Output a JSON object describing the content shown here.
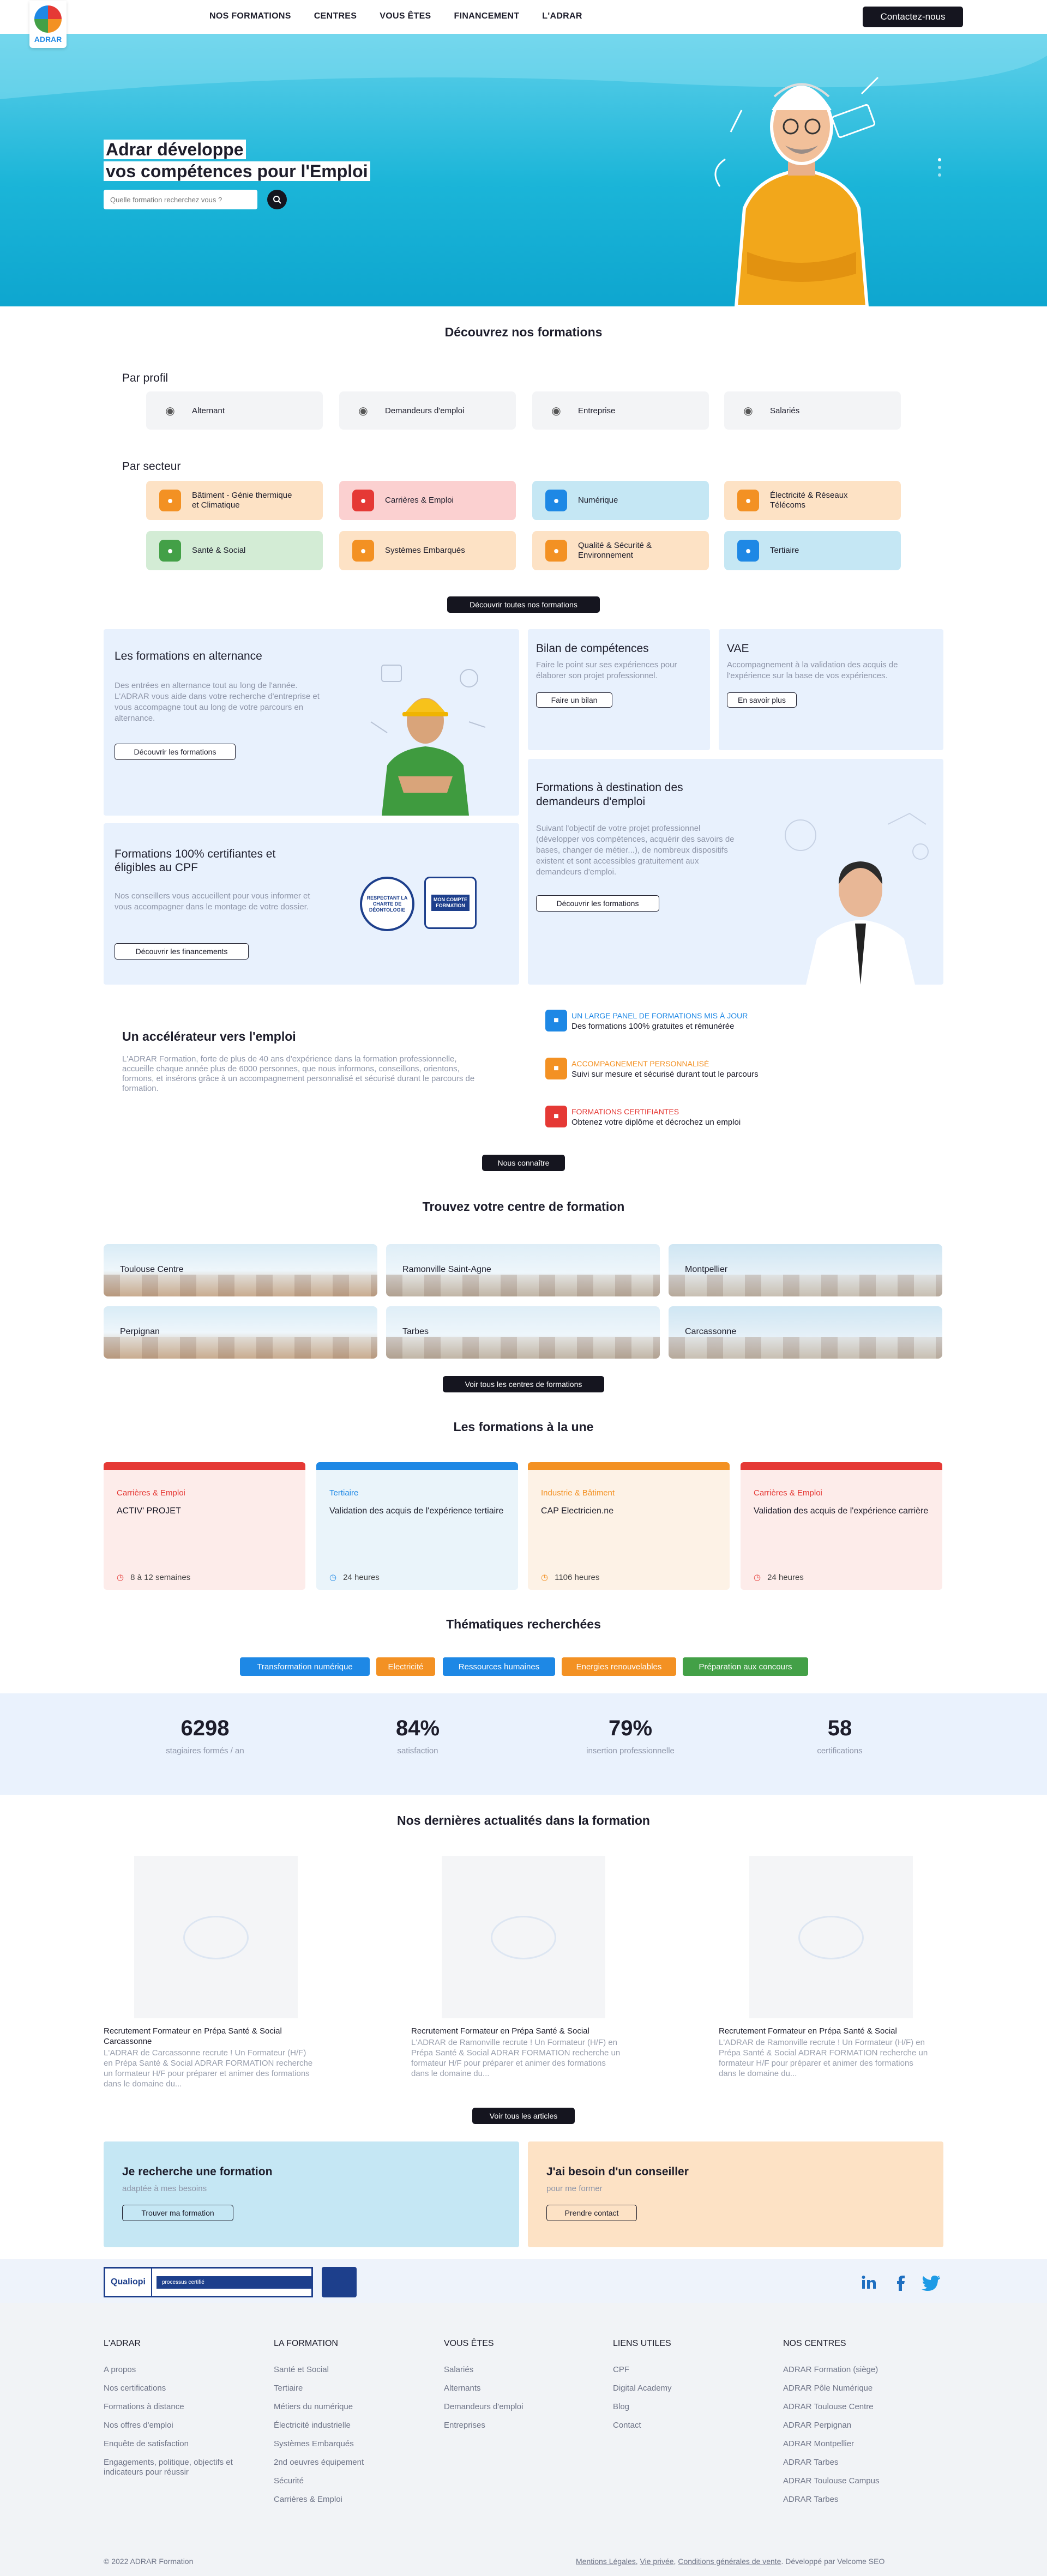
{
  "header": {
    "logo_text": "ADRAR",
    "nav": [
      "NOS FORMATIONS",
      "CENTRES",
      "VOUS ÊTES",
      "FINANCEMENT",
      "L'ADRAR"
    ],
    "cta": "Contactez-nous"
  },
  "hero": {
    "title_line1": "Adrar développe",
    "title_line2": "vos compétences pour l'Emploi",
    "search_placeholder": "Quelle formation recherchez vous ?"
  },
  "discover": {
    "title": "Découvrez nos formations",
    "profile_label": "Par profil",
    "profiles": [
      {
        "label": "Alternant",
        "icon": "person-icon"
      },
      {
        "label": "Demandeurs d'emploi",
        "icon": "job-seeker-icon"
      },
      {
        "label": "Entreprise",
        "icon": "building-icon"
      },
      {
        "label": "Salariés",
        "icon": "badge-icon"
      }
    ],
    "sector_label": "Par secteur",
    "sectors": [
      {
        "label": "Bâtiment - Génie thermique et Climatique",
        "bg": "#fde2c5",
        "icon_bg": "#f39123",
        "icon": "helmet-icon"
      },
      {
        "label": "Carrières & Emploi",
        "bg": "#fbd0d0",
        "icon_bg": "#e53935",
        "icon": "briefcase-icon"
      },
      {
        "label": "Numérique",
        "bg": "#c5e7f4",
        "icon_bg": "#1e88e5",
        "icon": "laptop-icon"
      },
      {
        "label": "Électricité & Réseaux Télécoms",
        "bg": "#fde2c5",
        "icon_bg": "#f39123",
        "icon": "bolt-icon"
      },
      {
        "label": "Santé & Social",
        "bg": "#d3ecd5",
        "icon_bg": "#43a047",
        "icon": "health-icon"
      },
      {
        "label": "Systèmes Embarqués",
        "bg": "#fde2c5",
        "icon_bg": "#f39123",
        "icon": "chip-icon"
      },
      {
        "label": "Qualité & Sécurité & Environnement",
        "bg": "#fde2c5",
        "icon_bg": "#f39123",
        "icon": "shield-icon"
      },
      {
        "label": "Tertiaire",
        "bg": "#c5e7f4",
        "icon_bg": "#1e88e5",
        "icon": "office-icon"
      }
    ],
    "all_button": "Découvrir toutes nos formations"
  },
  "cards": {
    "alternance": {
      "title": "Les formations en alternance",
      "text": "Des entrées en alternance tout au long de l'année. L'ADRAR vous aide dans votre recherche d'entreprise et vous accompagne tout au long de votre parcours en alternance.",
      "button": "Découvrir les formations"
    },
    "bilan": {
      "title": "Bilan de compétences",
      "text": "Faire le point sur ses expériences pour élaborer son projet professionnel.",
      "button": "Faire un bilan"
    },
    "vae": {
      "title": "VAE",
      "text": "Accompagnement à la validation des acquis de l'expérience sur la base de vos expériences.",
      "button": "En savoir plus"
    },
    "cpf": {
      "title": "Formations 100% certifiantes et éligibles au CPF",
      "text": "Nos conseillers vous accueillent pour vous informer et vous accompagner dans le montage de votre dossier.",
      "button": "Découvrir les financements",
      "badge1": "RESPECTANT LA CHARTE DE DÉONTOLOGIE",
      "badge2": "MON COMPTE FORMATION"
    },
    "demandeurs": {
      "title": "Formations à destination des demandeurs d'emploi",
      "text": "Suivant l'objectif de votre projet professionnel (développer vos compétences, acquérir des savoirs de bases, changer de métier...), de nombreux dispositifs existent et sont accessibles gratuitement aux demandeurs d'emploi.",
      "button": "Découvrir les formations"
    }
  },
  "accelerator": {
    "title": "Un accélérateur vers l'emploi",
    "text": "L'ADRAR Formation, forte de plus de 40 ans d'expérience dans la formation professionnelle, accueille chaque année plus de 6000 personnes, que nous informons, conseillons, orientons, formons, et insérons grâce à un accompagnement personnalisé et sécurisé durant le parcours de formation.",
    "points": [
      {
        "title": "UN LARGE PANEL DE FORMATIONS MIS À JOUR",
        "text": "Des formations 100% gratuites et rémunérée",
        "color": "#1e88e5",
        "icon": "list-icon"
      },
      {
        "title": "ACCOMPAGNEMENT PERSONNALISÉ",
        "text": "Suivi sur mesure et sécurisé durant tout le parcours",
        "color": "#f39123",
        "icon": "users-icon"
      },
      {
        "title": "FORMATIONS CERTIFIANTES",
        "text": "Obtenez votre diplôme et décrochez un emploi",
        "color": "#e53935",
        "icon": "certificate-icon"
      }
    ],
    "button": "Nous connaître"
  },
  "centres": {
    "title": "Trouvez votre centre de formation",
    "cities": [
      "Toulouse Centre",
      "Ramonville Saint-Agne",
      "Montpellier",
      "Perpignan",
      "Tarbes",
      "Carcassonne"
    ],
    "button": "Voir tous les centres de formations"
  },
  "featured": {
    "title": "Les formations à la une",
    "items": [
      {
        "category": "Carrières & Emploi",
        "title": "ACTIV' PROJET",
        "duration": "8 à 12 semaines",
        "color": "#e53935",
        "bg": "#fdecea"
      },
      {
        "category": "Tertiaire",
        "title": "Validation des acquis de l'expérience tertiaire",
        "duration": "24 heures",
        "color": "#1e88e5",
        "bg": "#eaf4fa"
      },
      {
        "category": "Industrie & Bâtiment",
        "title": "CAP Electricien.ne",
        "duration": "1106 heures",
        "color": "#f39123",
        "bg": "#fdf2e6"
      },
      {
        "category": "Carrières & Emploi",
        "title": "Validation des acquis de l'expérience carrière",
        "duration": "24 heures",
        "color": "#e53935",
        "bg": "#fdecea"
      }
    ]
  },
  "themes": {
    "title": "Thématiques recherchées",
    "tags": [
      {
        "label": "Transformation numérique",
        "color": "#1e88e5"
      },
      {
        "label": "Electricité",
        "color": "#f39123"
      },
      {
        "label": "Ressources humaines",
        "color": "#1e88e5"
      },
      {
        "label": "Energies renouvelables",
        "color": "#f39123"
      },
      {
        "label": "Préparation aux concours",
        "color": "#43a047"
      }
    ]
  },
  "stats": [
    {
      "value": "6298",
      "label": "stagiaires formés / an"
    },
    {
      "value": "84%",
      "label": "satisfaction"
    },
    {
      "value": "79%",
      "label": "insertion professionnelle"
    },
    {
      "value": "58",
      "label": "certifications"
    }
  ],
  "news": {
    "title": "Nos dernières actualités dans la formation",
    "items": [
      {
        "title": "Recrutement Formateur en Prépa Santé & Social Carcassonne",
        "text": "L'ADRAR de Carcassonne recrute ! Un Formateur (H/F) en Prépa Santé & Social ADRAR FORMATION recherche un formateur H/F pour préparer et animer des formations dans le domaine du..."
      },
      {
        "title": "Recrutement Formateur en Prépa Santé & Social",
        "text": "L'ADRAR de Ramonville recrute ! Un Formateur (H/F) en Prépa Santé & Social ADRAR FORMATION recherche un formateur H/F pour préparer et animer des formations dans le domaine du..."
      },
      {
        "title": "Recrutement Formateur en Prépa Santé & Social",
        "text": "L'ADRAR de Ramonville recrute ! Un Formateur (H/F) en Prépa Santé & Social ADRAR FORMATION recherche un formateur H/F pour préparer et animer des formations dans le domaine du..."
      }
    ],
    "button": "Voir tous les articles"
  },
  "cta_blocks": {
    "left": {
      "title": "Je recherche une formation",
      "sub": "adaptée à mes besoins",
      "button": "Trouver ma formation"
    },
    "right": {
      "title": "J'ai besoin d'un conseiller",
      "sub": "pour me former",
      "button": "Prendre contact"
    }
  },
  "partners": {
    "qualiopi": "Qualiopi",
    "qualiopi_sub": "processus certifié",
    "social": [
      "linkedin-icon",
      "facebook-icon",
      "twitter-icon"
    ]
  },
  "footer": {
    "columns": [
      {
        "title": "L'ADRAR",
        "items": [
          "A propos",
          "Nos certifications",
          "Formations à distance",
          "Nos offres d'emploi",
          "Enquête de satisfaction",
          "Engagements, politique, objectifs et indicateurs pour réussir"
        ]
      },
      {
        "title": "LA FORMATION",
        "items": [
          "Santé et Social",
          "Tertiaire",
          "Métiers du numérique",
          "Électricité industrielle",
          "Systèmes Embarqués",
          "2nd oeuvres équipement",
          "Sécurité",
          "Carrières & Emploi"
        ]
      },
      {
        "title": "VOUS ÊTES",
        "items": [
          "Salariés",
          "Alternants",
          "Demandeurs d'emploi",
          "Entreprises"
        ]
      },
      {
        "title": "LIENS UTILES",
        "items": [
          "CPF",
          "Digital Academy",
          "Blog",
          "Contact"
        ]
      },
      {
        "title": "NOS CENTRES",
        "items": [
          "ADRAR Formation (siège)",
          "ADRAR Pôle Numérique",
          "ADRAR Toulouse Centre",
          "ADRAR Perpignan",
          "ADRAR Montpellier",
          "ADRAR Tarbes",
          "ADRAR Toulouse Campus",
          "ADRAR Tarbes"
        ]
      }
    ],
    "copyright": "© 2022 ADRAR Formation",
    "legal": [
      "Mentions Légales",
      "Vie privée",
      "Conditions générales de vente"
    ],
    "dev": "Développé par Velcome SEO"
  }
}
